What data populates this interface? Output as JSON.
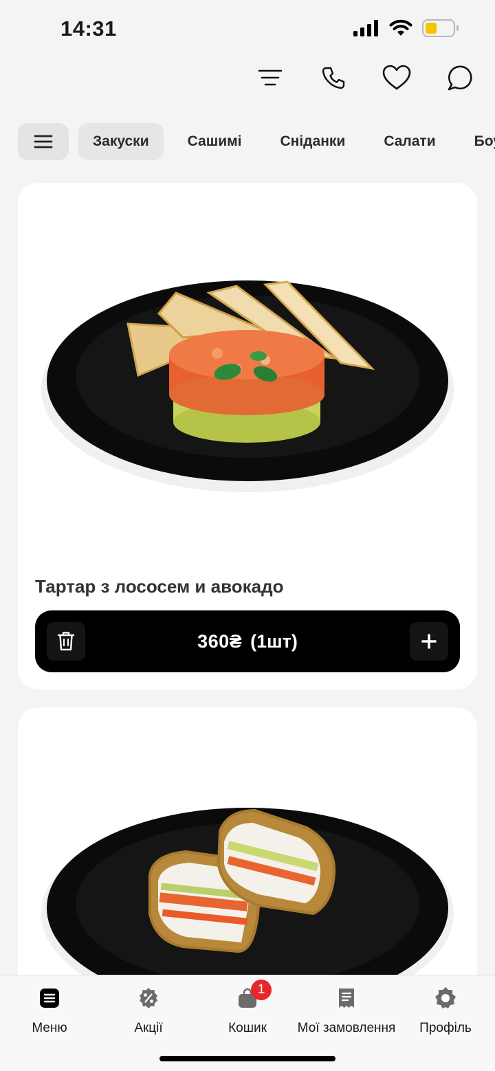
{
  "status_bar": {
    "time": "14:31"
  },
  "header": {
    "actions": [
      {
        "icon": "filter-icon"
      },
      {
        "icon": "phone-icon"
      },
      {
        "icon": "heart-icon"
      },
      {
        "icon": "chat-icon"
      }
    ]
  },
  "categories": {
    "menu_icon": "hamburger-icon",
    "tabs": [
      {
        "label": "Закуски",
        "active": true
      },
      {
        "label": "Сашимі"
      },
      {
        "label": "Сніданки"
      },
      {
        "label": "Салати"
      },
      {
        "label": "Боули"
      }
    ]
  },
  "products": [
    {
      "name": "Тартар з лососем и авокадо",
      "price": "360₴",
      "quantity": "(1шт)"
    },
    {
      "name": "",
      "image": "sushi-sandwich"
    }
  ],
  "bottom_nav": {
    "items": [
      {
        "label": "Меню",
        "icon": "menu-list-icon",
        "active": true
      },
      {
        "label": "Акції",
        "icon": "discount-icon"
      },
      {
        "label": "Кошик",
        "icon": "cart-icon",
        "badge": "1"
      },
      {
        "label": "Мої замовлення",
        "icon": "receipt-icon"
      },
      {
        "label": "Профіль",
        "icon": "profile-icon"
      }
    ]
  },
  "colors": {
    "accent": "#000000",
    "badge": "#e8262c",
    "background": "#f4f4f4",
    "battery": "#f5c400"
  }
}
